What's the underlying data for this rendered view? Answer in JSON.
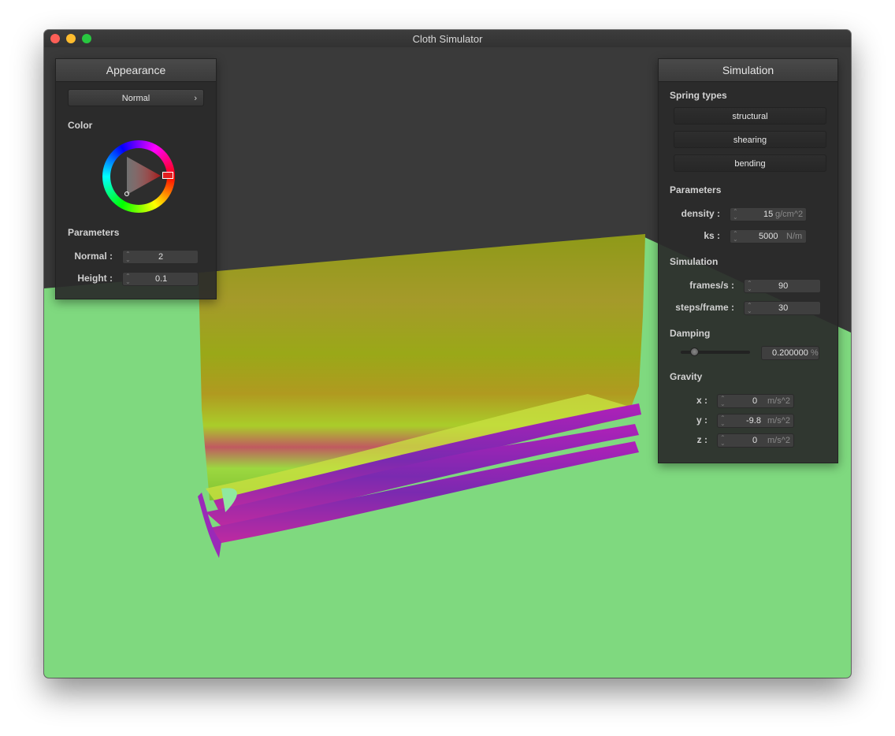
{
  "window": {
    "title": "Cloth Simulator"
  },
  "appearance": {
    "title": "Appearance",
    "shader_select": "Normal",
    "color_label": "Color",
    "parameters_label": "Parameters",
    "normal_label": "Normal :",
    "normal_value": "2",
    "height_label": "Height :",
    "height_value": "0.1"
  },
  "simulation": {
    "title": "Simulation",
    "spring_types_label": "Spring types",
    "structural_label": "structural",
    "shearing_label": "shearing",
    "bending_label": "bending",
    "parameters_label": "Parameters",
    "density_label": "density :",
    "density_value": "15",
    "density_unit": "g/cm^2",
    "ks_label": "ks :",
    "ks_value": "5000",
    "ks_unit": "N/m",
    "simulation_label": "Simulation",
    "fps_label": "frames/s :",
    "fps_value": "90",
    "steps_label": "steps/frame :",
    "steps_value": "30",
    "damping_label": "Damping",
    "damping_slider_fraction": 0.2,
    "damping_value": "0.200000",
    "damping_unit": "%",
    "gravity_label": "Gravity",
    "gx_label": "x :",
    "gx_value": "0",
    "gy_label": "y :",
    "gy_value": "-9.8",
    "gz_label": "z :",
    "gz_value": "0",
    "g_unit": "m/s^2"
  },
  "colors": {
    "floor": "#7fd97f",
    "sky": "#3a3a3a",
    "selected_color": "#e02020"
  }
}
